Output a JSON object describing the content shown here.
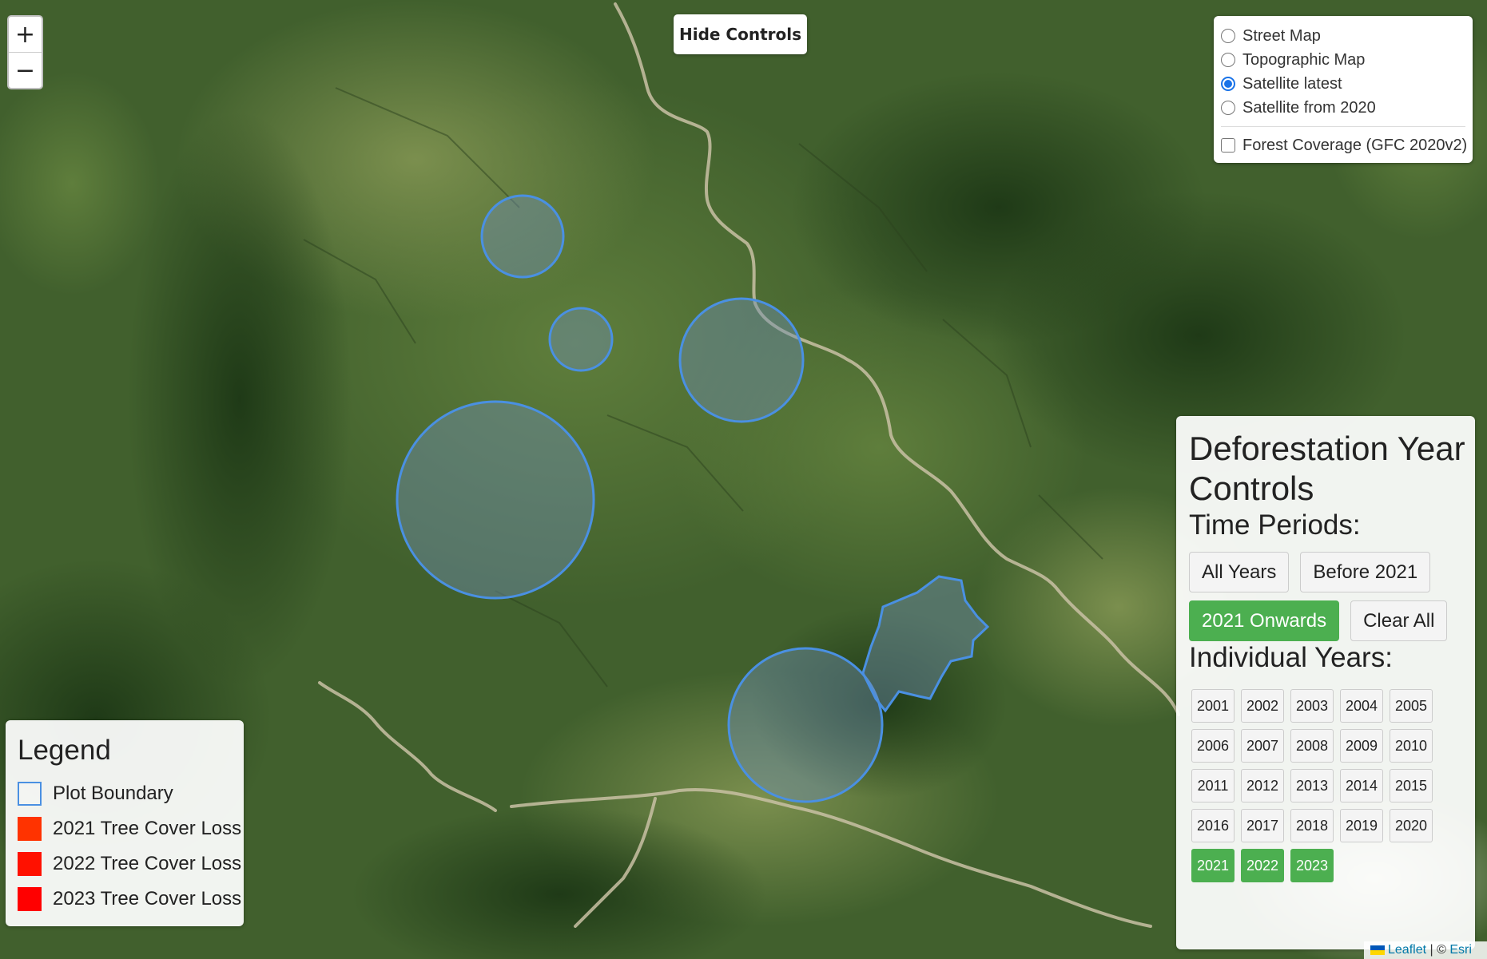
{
  "zoom": {
    "in_label": "+",
    "out_label": "−"
  },
  "hide_controls": {
    "label": "Hide Controls"
  },
  "layers": {
    "base_layers": [
      {
        "label": "Street Map",
        "selected": false
      },
      {
        "label": "Topographic Map",
        "selected": false
      },
      {
        "label": "Satellite latest",
        "selected": true
      },
      {
        "label": "Satellite from 2020",
        "selected": false
      }
    ],
    "overlays": [
      {
        "label": "Forest Coverage (GFC 2020v2)",
        "checked": false
      }
    ]
  },
  "deforestation": {
    "title": "Deforestation Year Controls",
    "time_periods_heading": "Time Periods:",
    "periods": [
      {
        "label": "All Years",
        "active": false
      },
      {
        "label": "Before 2021",
        "active": false
      },
      {
        "label": "2021 Onwards",
        "active": true
      },
      {
        "label": "Clear All",
        "active": false
      }
    ],
    "individual_years_heading": "Individual Years:",
    "years": [
      {
        "label": "2001",
        "active": false
      },
      {
        "label": "2002",
        "active": false
      },
      {
        "label": "2003",
        "active": false
      },
      {
        "label": "2004",
        "active": false
      },
      {
        "label": "2005",
        "active": false
      },
      {
        "label": "2006",
        "active": false
      },
      {
        "label": "2007",
        "active": false
      },
      {
        "label": "2008",
        "active": false
      },
      {
        "label": "2009",
        "active": false
      },
      {
        "label": "2010",
        "active": false
      },
      {
        "label": "2011",
        "active": false
      },
      {
        "label": "2012",
        "active": false
      },
      {
        "label": "2013",
        "active": false
      },
      {
        "label": "2014",
        "active": false
      },
      {
        "label": "2015",
        "active": false
      },
      {
        "label": "2016",
        "active": false
      },
      {
        "label": "2017",
        "active": false
      },
      {
        "label": "2018",
        "active": false
      },
      {
        "label": "2019",
        "active": false
      },
      {
        "label": "2020",
        "active": false
      },
      {
        "label": "2021",
        "active": true
      },
      {
        "label": "2022",
        "active": true
      },
      {
        "label": "2023",
        "active": true
      }
    ]
  },
  "legend": {
    "title": "Legend",
    "items": [
      {
        "label": "Plot Boundary",
        "kind": "boundary",
        "color": "#4a90e2"
      },
      {
        "label": "2021 Tree Cover Loss",
        "kind": "fill",
        "color": "#ff3300"
      },
      {
        "label": "2022 Tree Cover Loss",
        "kind": "fill",
        "color": "#ff1100"
      },
      {
        "label": "2023 Tree Cover Loss",
        "kind": "fill",
        "color": "#ff0000"
      }
    ]
  },
  "attribution": {
    "leaflet": "Leaflet",
    "separator": " | © ",
    "provider": "Esri"
  },
  "colors": {
    "plot_stroke": "#4a90e2",
    "plot_fill": "#6f8fb0",
    "active_button": "#4caf50",
    "radio_selected": "#1a73e8"
  }
}
